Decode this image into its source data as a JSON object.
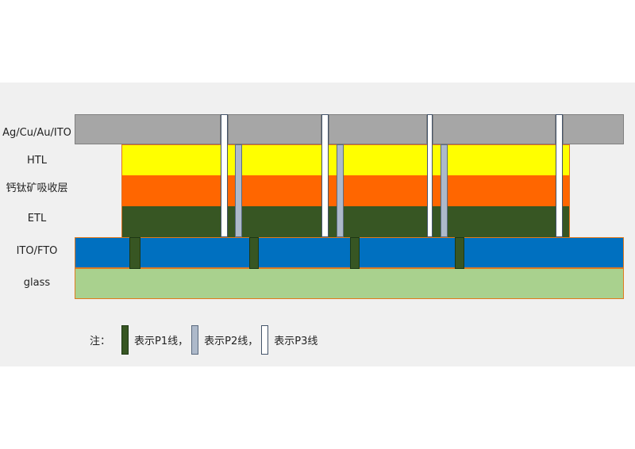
{
  "layers": [
    {
      "key": "electrode",
      "label": "Ag/Cu/Au/ITO"
    },
    {
      "key": "htl",
      "label": "HTL"
    },
    {
      "key": "absorber",
      "label": "钙钛矿吸收层"
    },
    {
      "key": "etl",
      "label": "ETL"
    },
    {
      "key": "tco",
      "label": "ITO/FTO"
    },
    {
      "key": "glass",
      "label": "glass"
    }
  ],
  "legend": {
    "prefix": "注：",
    "p1": "表示P1线，",
    "p2": "表示P2线，",
    "p3": "表示P3线"
  },
  "colors": {
    "electrode": "#a6a6a6",
    "htl": "#ffff00",
    "absorber": "#ff6600",
    "etl": "#375623",
    "tco": "#0070c0",
    "glass": "#a9d18e",
    "p1": "#375623",
    "p2": "#adb9ca",
    "p3": "#ffffff"
  }
}
